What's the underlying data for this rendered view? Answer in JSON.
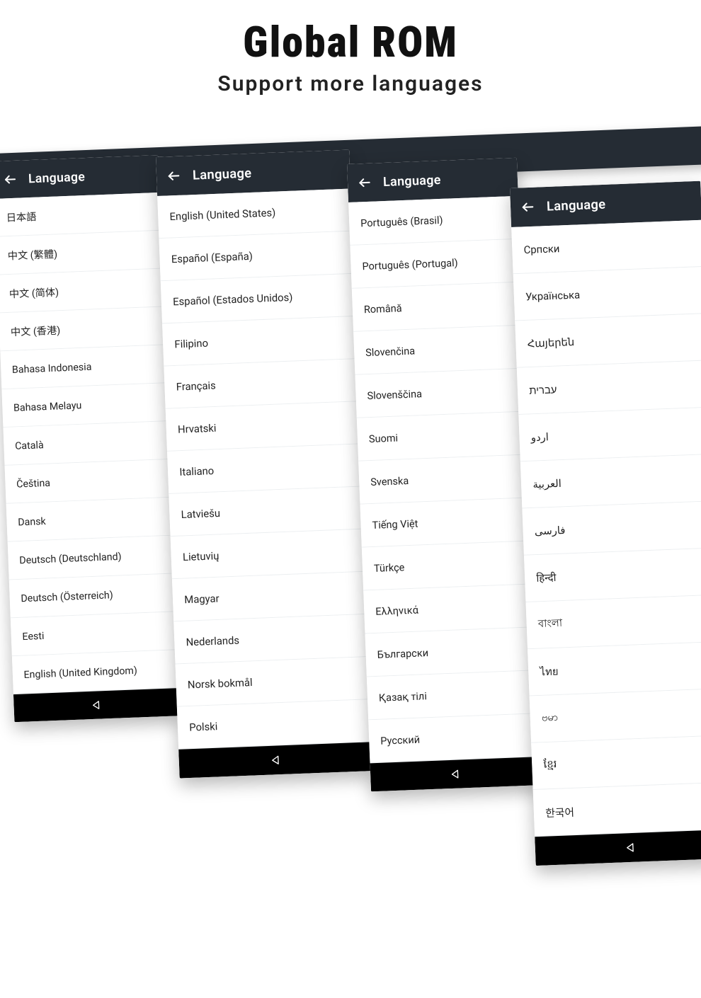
{
  "heading": {
    "title": "Global ROM",
    "subtitle": "Support more languages"
  },
  "appbar": {
    "title": "Language"
  },
  "screens": [
    {
      "id": 1,
      "items": [
        "日本語",
        "中文 (繁體)",
        "中文 (简体)",
        "中文 (香港)",
        "Bahasa Indonesia",
        "Bahasa Melayu",
        "Català",
        "Čeština",
        "Dansk",
        "Deutsch (Deutschland)",
        "Deutsch (Österreich)",
        "Eesti",
        "English (United Kingdom)"
      ]
    },
    {
      "id": 2,
      "items": [
        "English (United States)",
        "Español (España)",
        "Español (Estados Unidos)",
        "Filipino",
        "Français",
        "Hrvatski",
        "Italiano",
        "Latviešu",
        "Lietuvių",
        "Magyar",
        "Nederlands",
        "Norsk bokmål",
        "Polski"
      ]
    },
    {
      "id": 3,
      "items": [
        "Português (Brasil)",
        "Português (Portugal)",
        "Română",
        "Slovenčina",
        "Slovenščina",
        "Suomi",
        "Svenska",
        "Tiếng Việt",
        "Türkçe",
        "Ελληνικά",
        "Български",
        "Қазақ тілі",
        "Русский"
      ]
    },
    {
      "id": 4,
      "items": [
        "Српски",
        "Українська",
        "Հայերեն",
        "עברית",
        "اردو",
        "العربية",
        "فارسی",
        "हिन्दी",
        "বাংলা",
        "ไทย",
        "ဗမာ",
        "ខ្មែរ",
        "한국어"
      ]
    }
  ]
}
